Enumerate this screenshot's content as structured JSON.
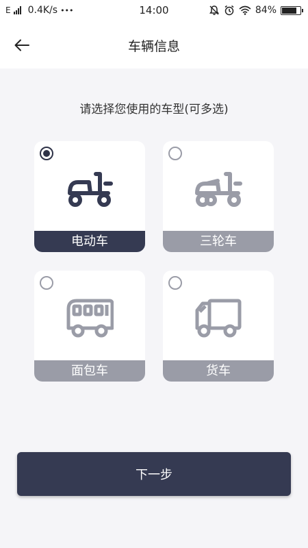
{
  "status_bar": {
    "network_type": "E",
    "speed": "0.4K/s",
    "more": "•••",
    "time": "14:00",
    "battery": "84%",
    "battery_level": 0.84,
    "icons": [
      "signal-icon",
      "mute-bell-icon",
      "alarm-icon",
      "wifi-icon",
      "battery-icon"
    ]
  },
  "header": {
    "back_icon": "back-arrow-icon",
    "title": "车辆信息"
  },
  "prompt": "请选择您使用的车型(可多选)",
  "vehicles": [
    {
      "label": "电动车",
      "icon": "electric-scooter-icon",
      "selected": true
    },
    {
      "label": "三轮车",
      "icon": "tricycle-icon",
      "selected": false
    },
    {
      "label": "面包车",
      "icon": "van-icon",
      "selected": false
    },
    {
      "label": "货车",
      "icon": "truck-icon",
      "selected": false
    }
  ],
  "next_button": "下一步",
  "colors": {
    "primary": "#353a52",
    "inactive": "#9a9ca7",
    "background": "#f5f5f8",
    "card": "#ffffff"
  }
}
